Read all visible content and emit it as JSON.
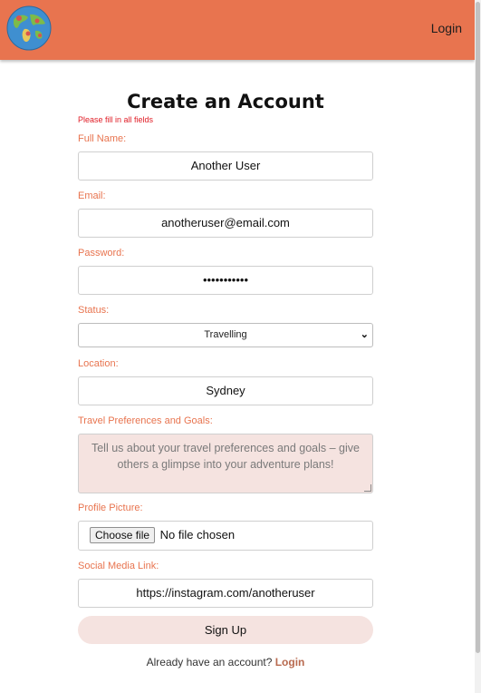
{
  "header": {
    "logo_icon": "globe-logo-icon",
    "login_label": "Login",
    "bg_color": "#e8744f"
  },
  "form": {
    "title": "Create an Account",
    "error": "Please fill in all fields",
    "full_name": {
      "label": "Full Name:",
      "value": "Another User"
    },
    "email": {
      "label": "Email:",
      "value": "anotheruser@email.com"
    },
    "password": {
      "label": "Password:",
      "value": "•••••••••••"
    },
    "status": {
      "label": "Status:",
      "value": "Travelling"
    },
    "location": {
      "label": "Location:",
      "value": "Sydney"
    },
    "travel": {
      "label": "Travel Preferences and Goals:",
      "placeholder": "Tell us about your travel preferences and goals – give others a glimpse into your adventure plans!"
    },
    "profile_picture": {
      "label": "Profile Picture:",
      "button_label": "Choose file",
      "status_text": "No file chosen"
    },
    "social": {
      "label": "Social Media Link:",
      "value": "https://instagram.com/anotheruser"
    },
    "submit_label": "Sign Up",
    "footer_text": "Already have an account?",
    "footer_link": "Login"
  },
  "colors": {
    "accent": "#e8744f",
    "error": "#e01b24",
    "pale_accent": "#f5e3e0"
  }
}
